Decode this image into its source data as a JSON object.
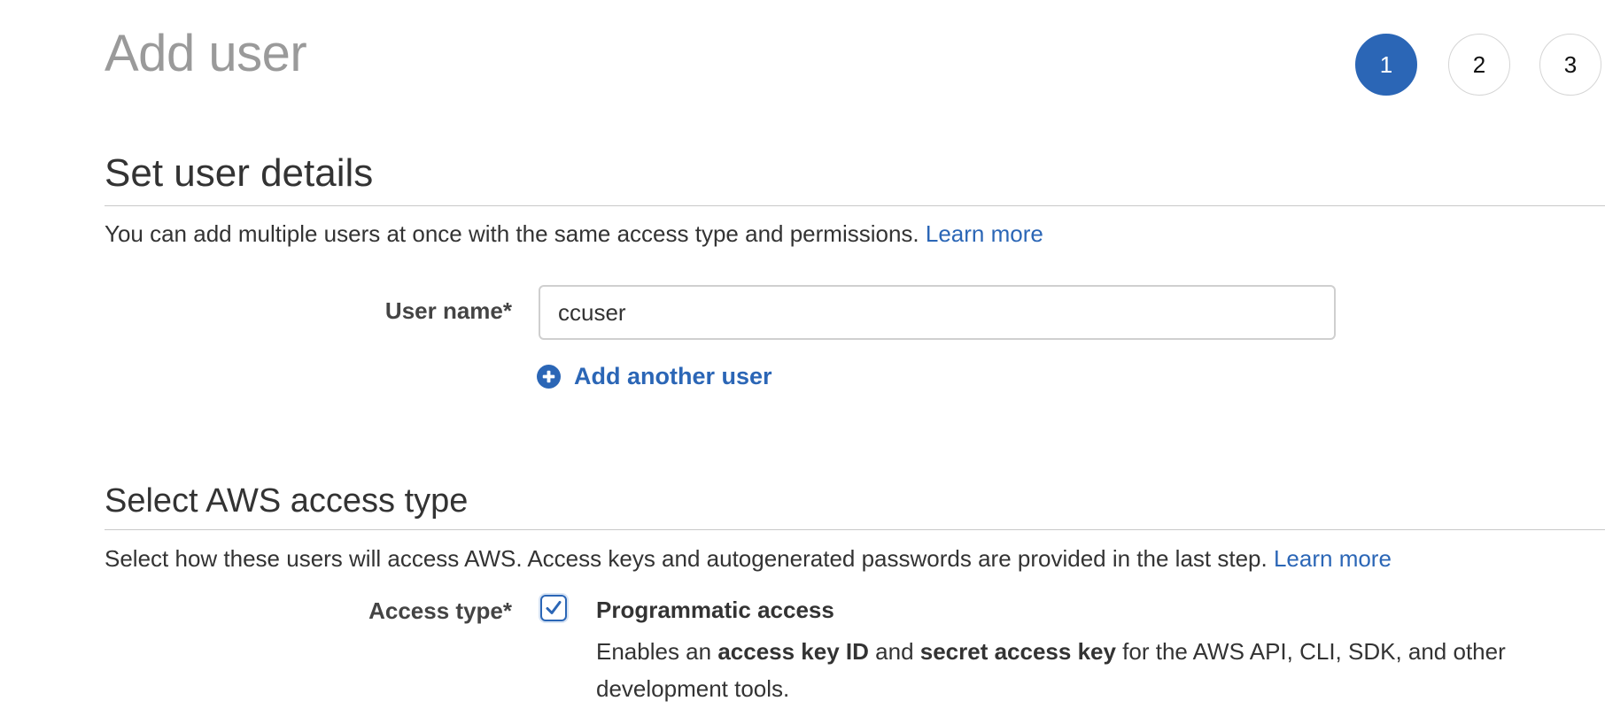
{
  "page": {
    "title": "Add user"
  },
  "stepper": {
    "steps": [
      "1",
      "2",
      "3"
    ],
    "active_step": "1",
    "active_color": "#2b66b6"
  },
  "user_details": {
    "heading": "Set user details",
    "description": "You can add multiple users at once with the same access type and permissions.",
    "learn_more": "Learn more",
    "user_name_label": "User name*",
    "user_name_value": "ccuser",
    "add_another_user": "Add another user"
  },
  "access_type": {
    "heading": "Select AWS access type",
    "description": "Select how these users will access AWS. Access keys and autogenerated passwords are provided in the last step.",
    "learn_more": "Learn more",
    "label": "Access type*",
    "programmatic": {
      "title": "Programmatic access",
      "checked": true,
      "desc_part1": "Enables an ",
      "desc_bold1": "access key ID",
      "desc_part2": " and ",
      "desc_bold2": "secret access key",
      "desc_part3": " for the AWS API, CLI, SDK, and other development tools."
    }
  },
  "colors": {
    "link": "#2b66b6",
    "title_gray": "#9a9a9a",
    "text": "#333333"
  }
}
